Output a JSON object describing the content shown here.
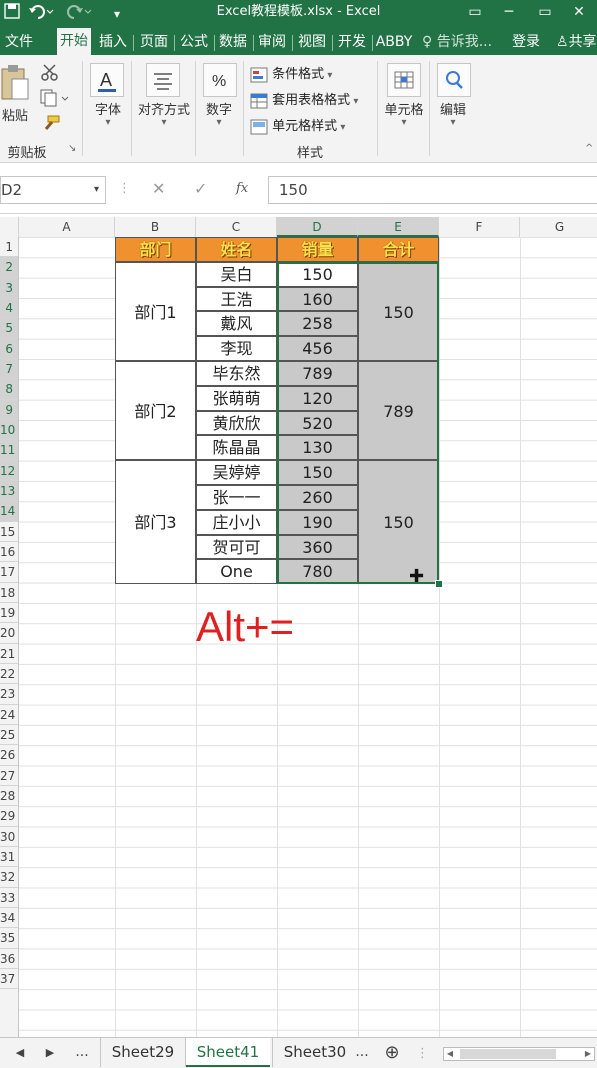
{
  "window": {
    "title": "Excel教程模板.xlsx - Excel",
    "undo_icon": "undo-icon",
    "redo_icon": "redo-icon",
    "minimize": "─",
    "restore": "▭",
    "close": "✕"
  },
  "tabs": [
    {
      "label": "文件",
      "active": false
    },
    {
      "label": "开始",
      "active": true
    },
    {
      "label": "插入",
      "active": false
    },
    {
      "label": "页面",
      "active": false
    },
    {
      "label": "公式",
      "active": false
    },
    {
      "label": "数据",
      "active": false
    },
    {
      "label": "审阅",
      "active": false
    },
    {
      "label": "视图",
      "active": false
    },
    {
      "label": "开发",
      "active": false
    },
    {
      "label": "ABBY",
      "active": false
    }
  ],
  "tellme": "告诉我...",
  "login": "登录",
  "share": "共享",
  "ribbon": {
    "clipboard": {
      "paste": "粘贴",
      "group": "剪贴板"
    },
    "font": "字体",
    "alignment": "对齐方式",
    "number": "数字",
    "styles": {
      "conditional": "条件格式",
      "table": "套用表格格式",
      "cell": "单元格样式",
      "group": "样式"
    },
    "cells": "单元格",
    "editing": "编辑"
  },
  "formula_bar": {
    "name_box": "D2",
    "cancel": "✕",
    "enter": "✓",
    "fx": "fx",
    "value": "150"
  },
  "columns": [
    "A",
    "B",
    "C",
    "D",
    "E",
    "F",
    "G"
  ],
  "rows": [
    "1",
    "2",
    "3",
    "4",
    "5",
    "6",
    "7",
    "8",
    "9",
    "10",
    "11",
    "12",
    "13",
    "14",
    "15",
    "16",
    "17",
    "18",
    "19",
    "20",
    "21",
    "22",
    "23",
    "24",
    "25",
    "26",
    "27",
    "28",
    "29",
    "30",
    "31",
    "32",
    "33",
    "34",
    "35",
    "36",
    "37"
  ],
  "table": {
    "headers": [
      "部门",
      "姓名",
      "销量",
      "合计"
    ],
    "departments": [
      {
        "name": "部门1",
        "total": "150",
        "people": [
          {
            "name": "吴白",
            "sales": "150"
          },
          {
            "name": "王浩",
            "sales": "160"
          },
          {
            "name": "戴风",
            "sales": "258"
          },
          {
            "name": "李现",
            "sales": "456"
          }
        ]
      },
      {
        "name": "部门2",
        "total": "789",
        "people": [
          {
            "name": "毕东然",
            "sales": "789"
          },
          {
            "name": "张萌萌",
            "sales": "120"
          },
          {
            "name": "黄欣欣",
            "sales": "520"
          },
          {
            "name": "陈晶晶",
            "sales": "130"
          }
        ]
      },
      {
        "name": "部门3",
        "total": "150",
        "people": [
          {
            "name": "吴婷婷",
            "sales": "150"
          },
          {
            "name": "张一一",
            "sales": "260"
          },
          {
            "name": "庄小小",
            "sales": "190"
          },
          {
            "name": "贺可可",
            "sales": "360"
          },
          {
            "name": "One",
            "sales": "780"
          }
        ]
      }
    ]
  },
  "overlay_text": "Alt+=",
  "sheets": [
    {
      "label": "Sheet29",
      "active": false
    },
    {
      "label": "Sheet41",
      "active": true
    },
    {
      "label": "Sheet30",
      "active": false
    }
  ],
  "sheet_nav": {
    "prev": "◀",
    "next": "▶",
    "more": "...",
    "more2": "...",
    "add": "⊕"
  },
  "colors": {
    "accent": "#217346",
    "header_fill": "#f0912f",
    "header_text": "#ffe14d",
    "selection_fill": "#c9c9c9",
    "overlay": "#e02020"
  }
}
